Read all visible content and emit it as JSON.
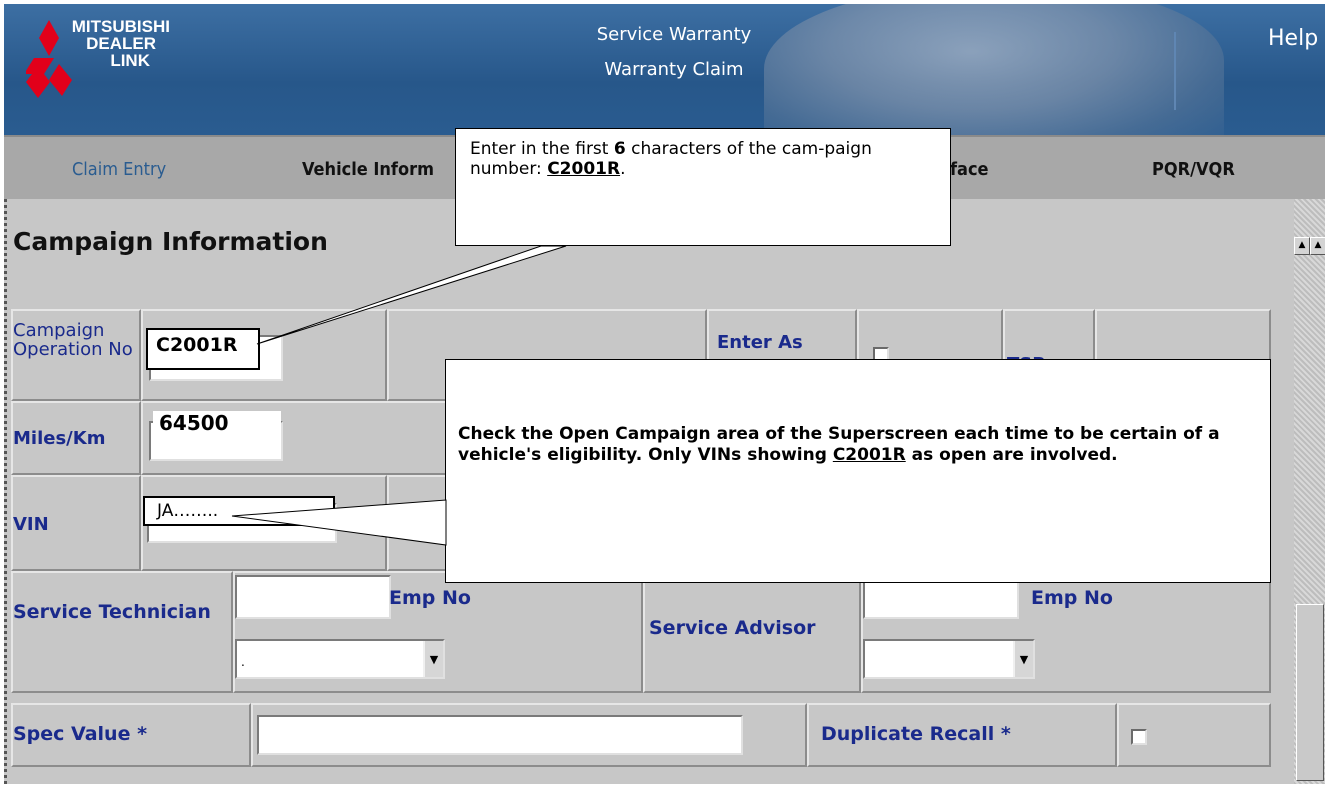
{
  "header": {
    "logo_line1": "MITSUBISHI",
    "logo_line2": "DEALER",
    "logo_line3": "LINK",
    "title1": "Service Warranty",
    "title2": "Warranty Claim",
    "help": "Help"
  },
  "nav": {
    "items": [
      {
        "label": "Claim Entry"
      },
      {
        "label": "Vehicle Inform"
      },
      {
        "label": "rface"
      },
      {
        "label": "PQR/VQR"
      }
    ]
  },
  "section": {
    "title": "Campaign Information"
  },
  "form": {
    "campaign_label": "Campaign Operation No",
    "campaign_value": "C2001R",
    "enter_as_label": "Enter As",
    "tsr_label": "TSR",
    "miles_label": "Miles/Km",
    "miles_value": "64500",
    "vin_label": "VIN",
    "vin_value": "JA……..",
    "service_technician_label": "Service Technician",
    "emp_no_label": "Emp No",
    "service_advisor_label": "Service Advisor",
    "emp_no_label2": "Emp No",
    "spec_value_label": "Spec Value *",
    "duplicate_recall_label": "Duplicate Recall *",
    "tech_select_value": "."
  },
  "callouts": {
    "top_pre": "Enter in the first ",
    "top_bold": "6",
    "top_mid": " characters of the cam-paign number: ",
    "top_code": "C2001R",
    "top_end": ".",
    "bottom_pre": "Check the Open Campaign area of the Superscreen each time to be certain of a vehicle's eligibility. Only VINs showing ",
    "bottom_code": "C2001R",
    "bottom_end": " as open are involved."
  },
  "colors": {
    "header_blue": "#2a5c90",
    "label_blue": "#1a2a8c",
    "panel_gray": "#c7c7c7",
    "logo_red": "#e2001a"
  }
}
